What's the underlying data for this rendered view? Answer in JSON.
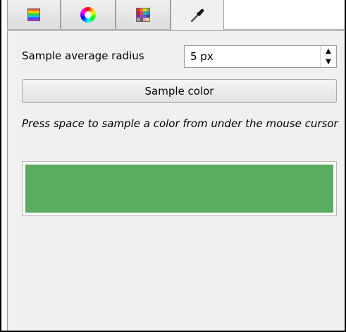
{
  "tabs": [
    {
      "icon": "gradient-icon",
      "selected": false
    },
    {
      "icon": "color-wheel-icon",
      "selected": false
    },
    {
      "icon": "palette-icon",
      "selected": false
    },
    {
      "icon": "eyedropper-icon",
      "selected": true
    }
  ],
  "sampler": {
    "radius_label": "Sample average radius",
    "radius_value": "5 px",
    "sample_button_label": "Sample color",
    "hint_text": "Press space to sample a color from under the mouse cursor",
    "sampled_color": "#5aac60"
  },
  "colors": {
    "panel_background": "#f0f0f0",
    "palette_icon_cells": [
      "#e03030",
      "#f08020",
      "#f0d020",
      "#80c030",
      "#c02050",
      "#e05050",
      "#30b0a0",
      "#2090d0",
      "#8030a0",
      "#c040c0",
      "#4060d0",
      "#3040a0",
      "#a0a0a0",
      "#606060",
      "#f0a0c0",
      "#f0e070"
    ]
  }
}
